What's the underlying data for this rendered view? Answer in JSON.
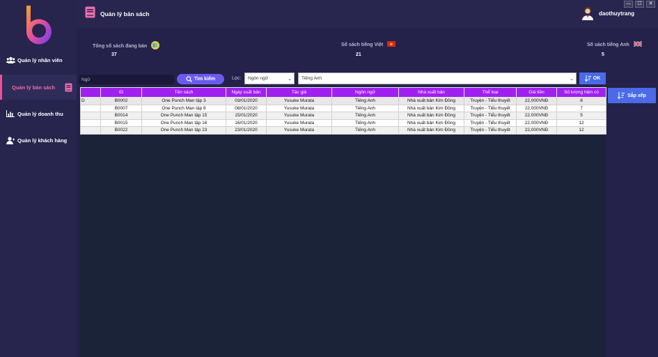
{
  "sidebar": {
    "items": [
      {
        "label": "Quản lý nhân viên",
        "icon": "users-icon"
      },
      {
        "label": "Quản lý bán sách",
        "icon": "book-icon"
      },
      {
        "label": "Quản lý doanh thu",
        "icon": "bar-chart-icon"
      },
      {
        "label": "Quản lý khách hàng",
        "icon": "user-icon"
      }
    ]
  },
  "header": {
    "title": "Quản lý bán sách",
    "username": "daothuytrang"
  },
  "window_controls": {
    "minimize": "—",
    "maximize": "☐",
    "close": "✕"
  },
  "stats": {
    "total_label": "Tổng số sách đang bán",
    "total_value": "37",
    "vietnamese_label": "Số sách tiếng Việt",
    "vietnamese_value": "21",
    "english_label": "Số sách tiếng Anh",
    "english_value": "5"
  },
  "toolbar": {
    "search_value": "Ngữ",
    "search_button": "Tìm kiếm",
    "filter_label": "Lọc:",
    "filter_field": "Ngôn ngữ",
    "filter_value": "Tiếng Anh",
    "ok_button": "OK",
    "sort_button": "Sắp xếp"
  },
  "table": {
    "columns": [
      "ID",
      "Tên sách",
      "Ngày xuất bản",
      "Tác giả",
      "Ngôn ngữ",
      "Nhà xuất bản",
      "Thể loại",
      "Giá tiền",
      "Số lượng hiện có"
    ],
    "row_marker": "D",
    "rows": [
      [
        "B0002",
        "One Punch Man tập 3",
        "03/01/2020",
        "Yusuke Murata",
        "Tiếng Anh",
        "Nhà xuất bản Kim Đồng",
        "Truyện - Tiểu thuyết",
        "22,000VNĐ",
        "8"
      ],
      [
        "B0007",
        "One Punch Man tập 8",
        "08/01/2020",
        "Yusuke Murata",
        "Tiếng Anh",
        "Nhà xuất bản Kim Đồng",
        "Truyện - Tiểu thuyết",
        "22,000VNĐ",
        "7"
      ],
      [
        "B0014",
        "One Punch Man tập 15",
        "15/01/2020",
        "Yusuke Murata",
        "Tiếng Anh",
        "Nhà xuất bản Kim Đồng",
        "Truyện - Tiểu thuyết",
        "22,000VNĐ",
        "5"
      ],
      [
        "B0015",
        "One Punch Man tập 16",
        "16/01/2020",
        "Yusuke Murata",
        "Tiếng Anh",
        "Nhà xuất bản Kim Đồng",
        "Truyện - Tiểu thuyết",
        "22,000VNĐ",
        "12"
      ],
      [
        "B0022",
        "One Punch Man tập 23",
        "23/01/2020",
        "Yusuke Murata",
        "Tiếng Anh",
        "Nhà xuất bản Kim Đồng",
        "Truyện - Tiểu thuyết",
        "22,000VNĐ",
        "12"
      ]
    ]
  },
  "colors": {
    "background": "#24224a",
    "header_purple": "#a020f0",
    "accent_blue": "#4a6ae8",
    "search_button": "#6a5bf0",
    "active_pink": "#f04e98"
  }
}
